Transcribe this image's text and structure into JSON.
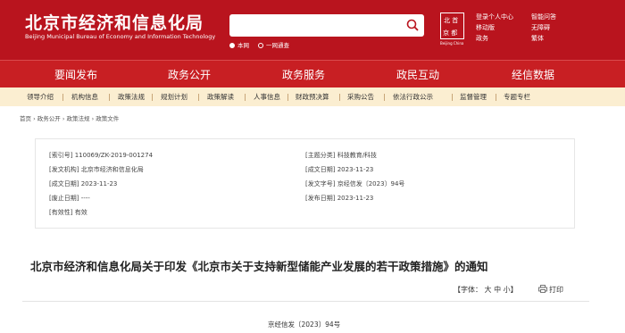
{
  "header": {
    "logo_cn": "北京市经济和信息化局",
    "logo_en": "Beijing Municipal Bureau of Economy and Information Technology",
    "seal_top": "北 首",
    "seal_bottom": "京 都",
    "seal_sub": "Beijing China",
    "search": {
      "value": "",
      "opt1": "本网",
      "opt2": "一网通查"
    },
    "links_col1": [
      "登录个人中心",
      "移动版",
      "政务"
    ],
    "links_col2": [
      "智能问答",
      "无障碍",
      "繁体"
    ]
  },
  "mainnav": [
    "要闻发布",
    "政务公开",
    "政务服务",
    "政民互动",
    "经信数据"
  ],
  "subnav": [
    "领导介绍",
    "机构信息",
    "政策法规",
    "规划计划",
    "政策解读",
    "人事信息",
    "财政预决算",
    "采购公告",
    "依法行政公示",
    "监督管理",
    "专题专栏"
  ],
  "breadcrumb": [
    "首页",
    "政务公开",
    "政策法规",
    "政策文件"
  ],
  "info": {
    "index_label": "[索引号]",
    "index_value": "110069/ZK-2019-001274",
    "category_label": "[主题分类]",
    "category_value": "科技教育/科技",
    "issuer_label": "[发文机构]",
    "issuer_value": "北京市经济和信息化局",
    "publish_date_label": "[成文日期]",
    "publish_date_value": "2023-11-23",
    "written_date_label": "[成文日期]",
    "written_date_value": "2023-11-23",
    "doc_no_label": "[发文字号]",
    "doc_no_value": "京经信发〔2023〕94号",
    "expire_label": "[废止日期]",
    "expire_value": "----",
    "release_label": "[发布日期]",
    "release_value": "2023-11-23",
    "validity_label": "[有效性]",
    "validity_value": "有效"
  },
  "article": {
    "title": "北京市经济和信息化局关于印发《北京市关于支持新型储能产业发展的若干政策措施》的通知",
    "font_label": "【字体：",
    "font_large": "大",
    "font_medium": "中",
    "font_small": "小】",
    "print_label": "打印",
    "doc_number": "京经信发〔2023〕94号"
  }
}
